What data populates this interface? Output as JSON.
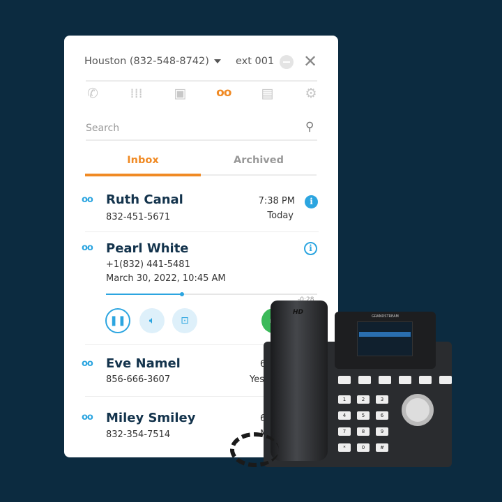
{
  "header": {
    "location": "Houston (832-548-8742)",
    "extension": "ext 001"
  },
  "nav": {
    "icons": [
      "phone-icon",
      "dialpad-icon",
      "contacts-icon",
      "voicemail-icon",
      "fax-icon",
      "gear-icon"
    ],
    "active": "voicemail-icon"
  },
  "search": {
    "placeholder": "Search"
  },
  "tabs": [
    {
      "label": "Inbox",
      "active": true
    },
    {
      "label": "Archived",
      "active": false
    }
  ],
  "colors": {
    "accent": "#f08a24",
    "blue": "#2ca5e0",
    "background": "#0c2b40",
    "name": "#13334c"
  },
  "voicemails": [
    {
      "name": "Ruth Canal",
      "number": "832-451-5671",
      "time": "7:38 PM",
      "day": "Today"
    },
    {
      "name": "Pearl White",
      "number": "+1(832) 441-5481",
      "date": "March 30, 2022, 10:45 AM",
      "progress_percent": 36,
      "remaining": "-0:28"
    },
    {
      "name": "Eve Namel",
      "number": "856-666-3607",
      "time": "6:4",
      "day": "Yeste"
    },
    {
      "name": "Miley Smiley",
      "number": "832-354-7514",
      "time": "6",
      "day": "M"
    }
  ],
  "phone": {
    "handset_logo": "HD",
    "brand": "GRANDSTREAM"
  }
}
